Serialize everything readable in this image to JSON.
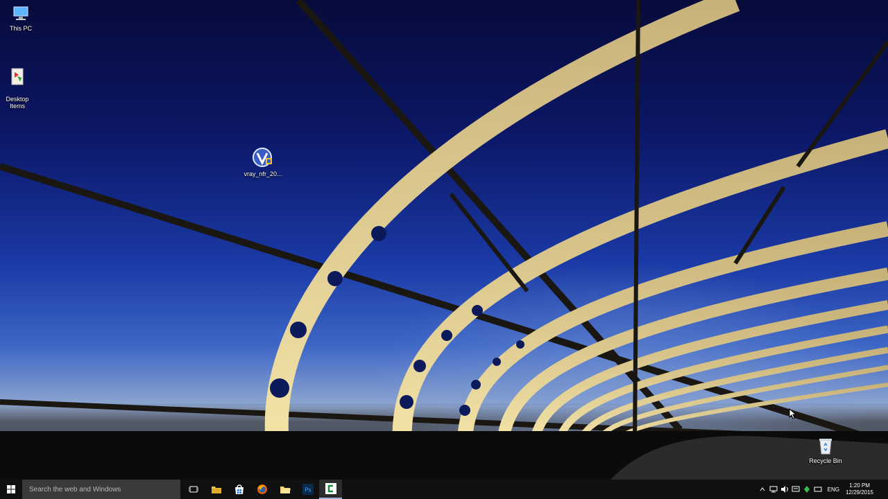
{
  "desktop": {
    "icons": [
      {
        "label": "This PC",
        "icon": "this-pc-icon"
      },
      {
        "label": "Desktop\nItems",
        "icon": "desktop-items-icon"
      },
      {
        "label": "vray_nfr_20...",
        "icon": "vray-installer-icon"
      },
      {
        "label": "Recycle Bin",
        "icon": "recycle-bin-icon"
      }
    ]
  },
  "taskbar": {
    "search_placeholder": "Search the web and Windows",
    "pinned": [
      {
        "name": "task-view",
        "icon": "task-view-icon"
      },
      {
        "name": "file-explorer",
        "icon": "folder-icon"
      },
      {
        "name": "store",
        "icon": "store-icon"
      },
      {
        "name": "firefox",
        "icon": "firefox-icon"
      },
      {
        "name": "file-manager",
        "icon": "folder-yellow-icon"
      },
      {
        "name": "photoshop",
        "icon": "photoshop-icon",
        "text": "Ps"
      },
      {
        "name": "camtasia",
        "icon": "camtasia-icon",
        "active": true
      }
    ],
    "tray": {
      "language": "ENG",
      "time": "1:20 PM",
      "date": "12/29/2015"
    }
  },
  "colors": {
    "taskbar_bg": "#101010",
    "search_bg": "#3a3a3a",
    "active_indicator": "#9ab0d8"
  }
}
